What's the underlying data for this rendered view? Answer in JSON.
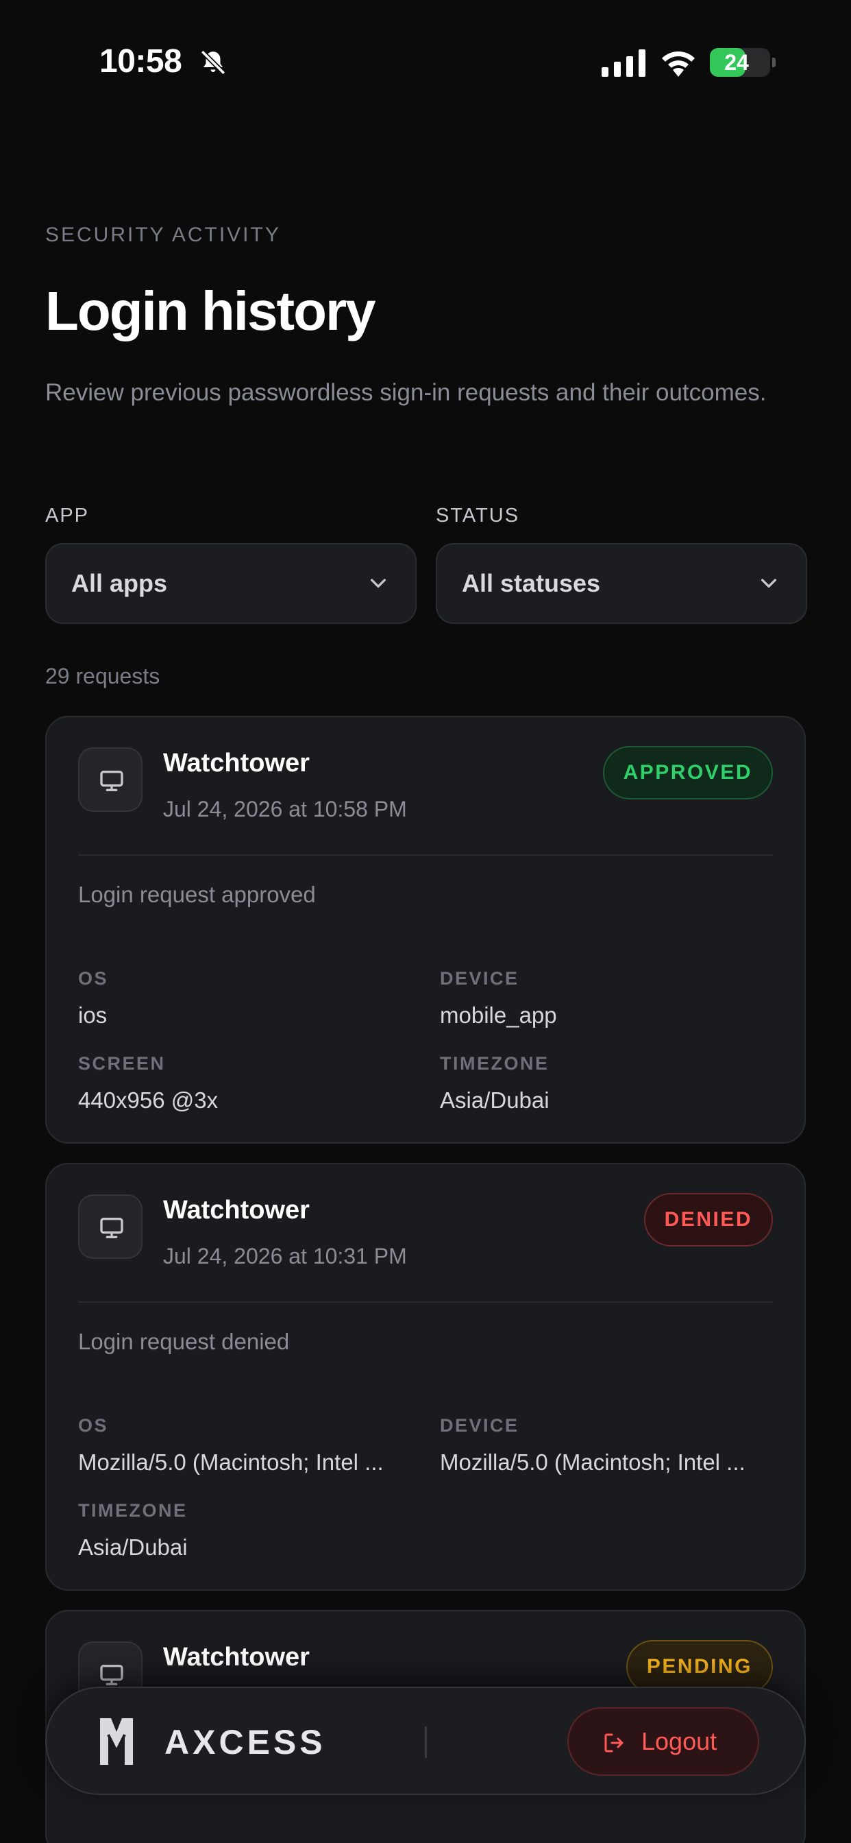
{
  "status_bar": {
    "time": "10:58",
    "battery": "24",
    "battery_level": 0.24
  },
  "header": {
    "eyebrow": "SECURITY ACTIVITY",
    "title": "Login history",
    "subtitle": "Review previous passwordless sign-in requests and their outcomes."
  },
  "filters": {
    "app": {
      "label": "APP",
      "value": "All apps"
    },
    "status": {
      "label": "STATUS",
      "value": "All statuses"
    }
  },
  "count": "29 requests",
  "cards": [
    {
      "app": "Watchtower",
      "date": "Jul 24, 2026 at 10:58 PM",
      "status": "APPROVED",
      "message": "Login request approved",
      "fields": [
        {
          "label": "OS",
          "value": "ios"
        },
        {
          "label": "DEVICE",
          "value": "mobile_app"
        },
        {
          "label": "SCREEN",
          "value": "440x956 @3x"
        },
        {
          "label": "TIMEZONE",
          "value": "Asia/Dubai"
        }
      ]
    },
    {
      "app": "Watchtower",
      "date": "Jul 24, 2026 at 10:31 PM",
      "status": "DENIED",
      "message": "Login request denied",
      "fields": [
        {
          "label": "OS",
          "value": "Mozilla/5.0 (Macintosh; Intel ..."
        },
        {
          "label": "DEVICE",
          "value": "Mozilla/5.0 (Macintosh; Intel ..."
        },
        {
          "label": "TIMEZONE",
          "value": "Asia/Dubai"
        }
      ]
    },
    {
      "app": "Watchtower",
      "status": "PENDING"
    }
  ],
  "bottom_bar": {
    "brand": "AXCESS",
    "logout_label": "Logout"
  },
  "colors": {
    "approved": "#2fd06b",
    "denied": "#ff5a55",
    "pending": "#f2b11b",
    "background": "#0b0b0c"
  },
  "icons": [
    "bell-slash-icon",
    "signal-icon",
    "wifi-icon",
    "battery-icon",
    "chevron-down-icon",
    "monitor-icon",
    "logout-icon"
  ]
}
